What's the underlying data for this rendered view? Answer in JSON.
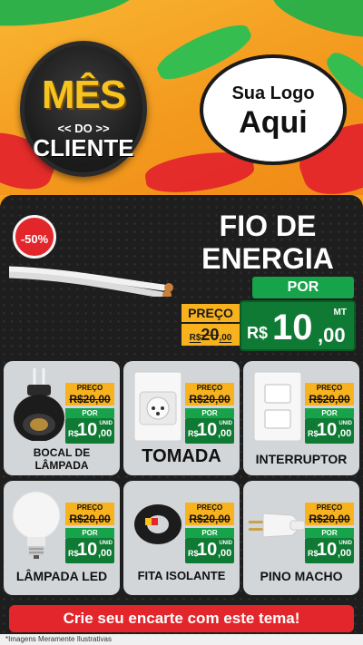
{
  "hero": {
    "badge": {
      "line1": "MÊS",
      "line2": "<< DO >>",
      "line3": "CLIENTE"
    },
    "logo": {
      "line1": "Sua Logo",
      "line2": "Aqui"
    }
  },
  "featured": {
    "discount": "-50%",
    "title_line1": "FIO DE",
    "title_line2": "ENERGIA",
    "preco_label": "PREÇO",
    "old_currency": "R$",
    "old_int": "20",
    "old_dec": ",00",
    "por_label": "POR",
    "new_currency": "R$",
    "new_int": "10",
    "new_dec": ",00",
    "unit": "MT"
  },
  "products": [
    {
      "name_line1": "BOCAL DE",
      "name_line2": "LÂMPADA",
      "preco_label": "PREÇO",
      "old": "R$20,00",
      "por_label": "POR",
      "currency": "R$",
      "int": "10",
      "dec": ",00",
      "unit": "UNID",
      "icon": "lamp-socket-icon"
    },
    {
      "name_line1": "TOMADA",
      "name_line2": "",
      "preco_label": "PREÇO",
      "old": "R$20,00",
      "por_label": "POR",
      "currency": "R$",
      "int": "10",
      "dec": ",00",
      "unit": "UNID",
      "icon": "outlet-icon"
    },
    {
      "name_line1": "INTERRUPTOR",
      "name_line2": "",
      "preco_label": "PREÇO",
      "old": "R$20,00",
      "por_label": "POR",
      "currency": "R$",
      "int": "10",
      "dec": ",00",
      "unit": "UNID",
      "icon": "switch-icon"
    },
    {
      "name_line1": "LÂMPADA LED",
      "name_line2": "",
      "preco_label": "PREÇO",
      "old": "R$20,00",
      "por_label": "POR",
      "currency": "R$",
      "int": "10",
      "dec": ",00",
      "unit": "UNID",
      "icon": "led-bulb-icon"
    },
    {
      "name_line1": "FITA ISOLANTE",
      "name_line2": "",
      "preco_label": "PREÇO",
      "old": "R$20,00",
      "por_label": "POR",
      "currency": "R$",
      "int": "10",
      "dec": ",00",
      "unit": "UNID",
      "icon": "tape-icon"
    },
    {
      "name_line1": "PINO MACHO",
      "name_line2": "",
      "preco_label": "PREÇO",
      "old": "R$20,00",
      "por_label": "POR",
      "currency": "R$",
      "int": "10",
      "dec": ",00",
      "unit": "UNID",
      "icon": "plug-icon"
    }
  ],
  "cta": "Crie seu encarte com este tema!",
  "disclaimer": "*Imagens Meramente Ilustrativas",
  "colors": {
    "accent_red": "#e3262b",
    "price_green": "#0f7a33",
    "price_yellow": "#f7b21e",
    "bg_orange": "#f39a1e"
  }
}
